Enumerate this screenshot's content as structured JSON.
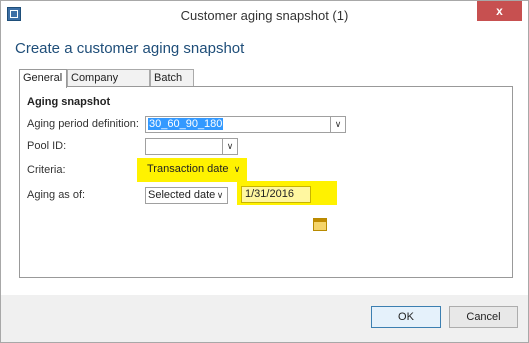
{
  "window": {
    "title": "Customer aging snapshot (1)",
    "close_glyph": "x"
  },
  "heading": "Create a customer aging snapshot",
  "tabs": [
    {
      "label": "General",
      "active": true
    },
    {
      "label": "Company range",
      "active": false
    },
    {
      "label": "Batch",
      "active": false
    }
  ],
  "group": {
    "title": "Aging snapshot"
  },
  "fields": {
    "aging_period": {
      "label": "Aging period definition:",
      "value": "30_60_90_180"
    },
    "pool_id": {
      "label": "Pool ID:",
      "value": ""
    },
    "criteria": {
      "label": "Criteria:",
      "value": "Transaction date"
    },
    "aging_as_of": {
      "label": "Aging as of:",
      "value": "Selected date",
      "date": "1/31/2016"
    }
  },
  "buttons": {
    "ok": "OK",
    "cancel": "Cancel"
  },
  "icons": {
    "dropdown": "chevron-down-icon",
    "calendar": "calendar-icon"
  },
  "colors": {
    "highlight": "#fff200",
    "title_accent": "#1f4e79",
    "close": "#c75050",
    "selection": "#3399ff"
  }
}
